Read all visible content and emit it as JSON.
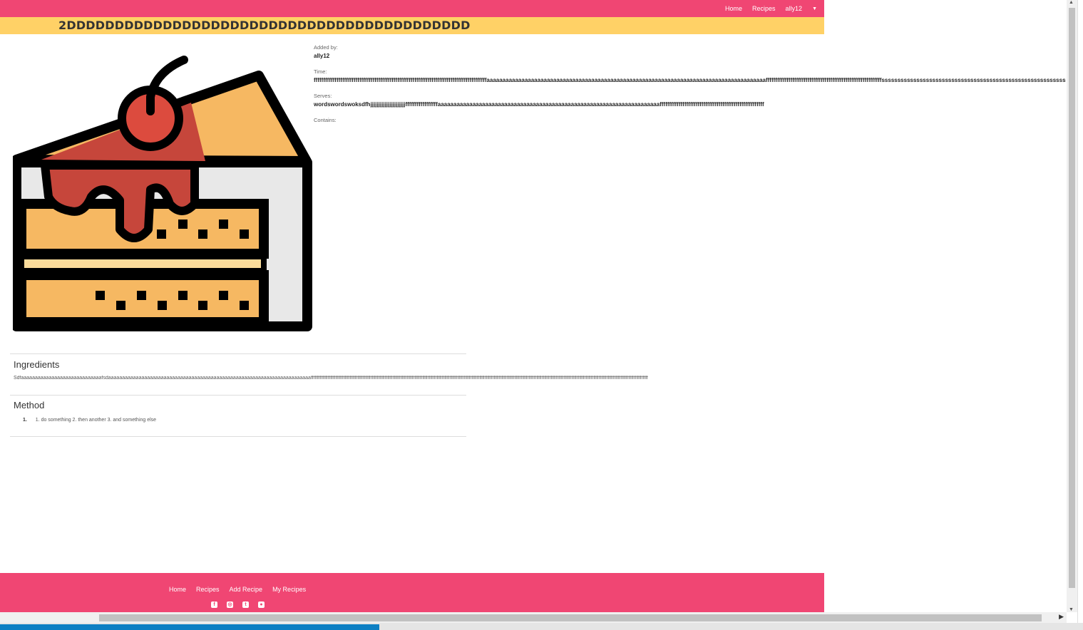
{
  "nav": {
    "home": "Home",
    "recipes": "Recipes",
    "user": "ally12"
  },
  "recipe": {
    "title": "2DDDDDDDDDDDDDDDDDDDDDDDDDDDDDDDDDDDDDDDDDD",
    "added_by_label": "Added by:",
    "added_by": "ally12",
    "time_label": "Time:",
    "time": "fffffffffffffffffffffffffffffffffffffffffffffffffffffffffffffffffffffffffffffffffffffffffffaaaaaaaaaaaaaaaaaaaaaaaaaaaaaaaaaaaaaaaaaaaaaaaaaaaaaaaaaaaaaaaaaaaaaaaaaaaaaaaaaaaaaaaafffffffffffffffffffffffffffffffffffffffffffffffffffffffffffffssssssssssssssssssssssssssssssssssssssssssssssssssssssssssssssssssssssssssssssssssss",
    "serves_label": "Serves:",
    "serves": "wordswordswoksdfhjjjjjjjjjjjjjjjjjjjjjjfffffffffffffffffaaaaaaaaaaaaaaaaaaaaaaaaaaaaaaaaaaaaaaaaaaaaaaaaaaaaaaaaaaaaaaaaaaaaaafffffffffffffffffffffffffffffffffffffffffffffffffffffff",
    "contains_label": "Contains:",
    "contains": ""
  },
  "ingredients": {
    "heading": "Ingredients",
    "text": "Sdfaaaaaaaaaaaaaaaaaaaaaaaaaaaaafsdaaaaaaaaaaaaaaaaaaaaaaaaaaaaaaaaaaaaaaaaaaaaaaaaaaaaaaaaaaaaaaaaaaaaaaaaaffffffffffffffffffffffffffffffffffffffffffffffffffffffffffffffffffffffffffffffffffffffffffffffffffffffffffffffffffffffffffffffffffffffffffffffffffffffffffffffffffffffffffffffffffffffffffffffffffffffffffffffffffffffffffffffffffffffffffffffffffffffffffffffffffff"
  },
  "method": {
    "heading": "Method",
    "steps": [
      {
        "num": "1.",
        "text": "1. do something 2. then another 3. and something else"
      }
    ]
  },
  "footer": {
    "home": "Home",
    "recipes": "Recipes",
    "add_recipe": "Add Recipe",
    "my_recipes": "My Recipes",
    "social_icons": [
      "facebook-icon",
      "instagram-icon",
      "twitter-icon",
      "github-icon"
    ]
  },
  "colors": {
    "brand_pink": "#f04673",
    "title_yellow": "#ffd166",
    "cake_sponge": "#f6b862",
    "cake_cream": "#fbdc9b",
    "cherry_red": "#dc4b3e",
    "sauce_red": "#c6463b",
    "plate_gray": "#e8e8e8"
  }
}
